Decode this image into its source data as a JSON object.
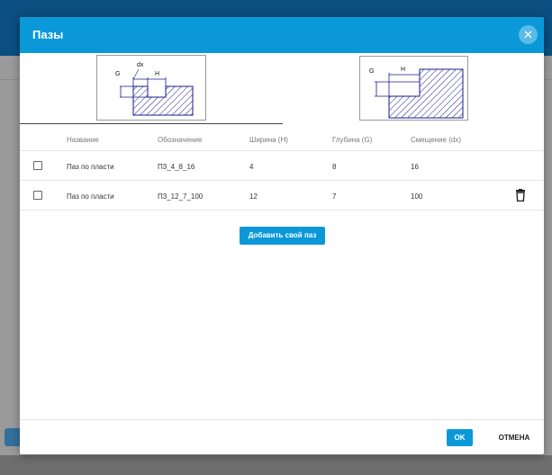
{
  "dialog": {
    "title": "Пазы",
    "close_icon": "close-icon"
  },
  "diagrams": {
    "groove_labels": {
      "g": "G",
      "dx": "dx",
      "h": "H"
    },
    "edge_labels": {
      "g": "G",
      "h": "H"
    }
  },
  "table": {
    "columns": {
      "name": "Название",
      "code": "Обозначение",
      "width": "Ширина (H)",
      "depth": "Глубина (G)",
      "offset": "Смещение (dx)"
    },
    "rows": [
      {
        "name": "Паз по пласти",
        "code": "П3_4_8_16",
        "width": "4",
        "depth": "8",
        "offset": "16"
      },
      {
        "name": "Паз по пласти",
        "code": "П3_12_7_100",
        "width": "12",
        "depth": "7",
        "offset": "100"
      }
    ]
  },
  "add_button": "Добавить свой паз",
  "footer": {
    "ok": "OK",
    "cancel": "ОТМЕНА"
  },
  "colors": {
    "primary": "#0b98d9",
    "hatch": "#1a1a8c"
  }
}
